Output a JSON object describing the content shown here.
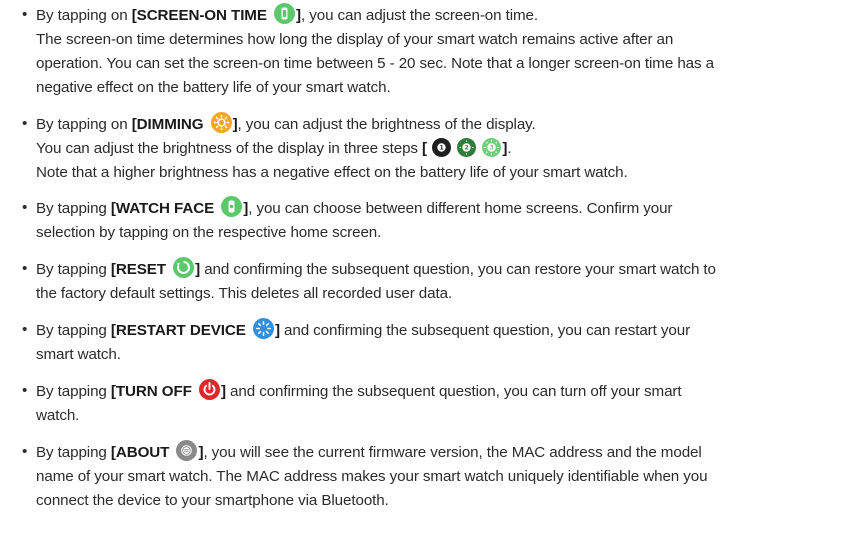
{
  "bullet_char": "•",
  "items": [
    {
      "lead": "By tapping on ",
      "name": "[SCREEN-ON TIME",
      "close": "]",
      "rest": ", you can adjust the screen-on time.",
      "lines": [
        "The screen-on time determines how long the display of your smart watch remains active after an",
        "operation. You can set the screen-on time between 5 - 20 sec. Note that a longer screen-on time has a",
        "negative effect on the battery life of your smart watch."
      ]
    },
    {
      "lead": "By tapping on ",
      "name": "[DIMMING",
      "close": "]",
      "rest": ", you can adjust the brightness of the display.",
      "steps_lead": "You can adjust the brightness of the display in three steps ",
      "steps_open": "[",
      "steps_close": "]",
      "steps_tail": ".",
      "step_labels": [
        "1",
        "2",
        "3"
      ],
      "note": "Note that a higher brightness has a negative effect on the battery life of your smart watch."
    },
    {
      "lead": "By tapping ",
      "name": "[WATCH FACE",
      "close": "]",
      "rest": ", you can choose between different home screens. Confirm your",
      "lines": [
        "selection by tapping on the respective home screen."
      ]
    },
    {
      "lead": "By tapping ",
      "name": "[RESET",
      "close": "]",
      "rest": " and confirming the subsequent question, you can restore your smart watch to",
      "lines": [
        "the factory default settings. This deletes all recorded user data."
      ]
    },
    {
      "lead": "By tapping ",
      "name": "[RESTART DEVICE",
      "close": "]",
      "rest": " and confirming the subsequent question, you can restart your",
      "lines": [
        "smart watch."
      ]
    },
    {
      "lead": "By tapping ",
      "name": "[TURN OFF",
      "close": "]",
      "rest": " and confirming the subsequent question, you can turn off your smart",
      "lines": [
        "watch."
      ]
    },
    {
      "lead": "By tapping ",
      "name": "[ABOUT",
      "close": "]",
      "rest": ", you will see the current firmware version, the MAC address and the model",
      "lines": [
        "name of your smart watch. The MAC address makes your smart watch uniquely identifiable when you",
        "connect the device to your smartphone via Bluetooth."
      ]
    }
  ],
  "icons": {
    "screen_on_time": "watch-icon",
    "dimming": "sun-icon",
    "step_1": "brightness-level-1-icon",
    "step_2": "brightness-level-2-icon",
    "step_3": "brightness-level-3-icon",
    "watch_face": "watch-face-icon",
    "reset": "reset-icon",
    "restart": "restart-spinner-icon",
    "turn_off": "power-icon",
    "about": "info-icon"
  },
  "colors": {
    "screen_on_time": "#5cc86a",
    "dimming": "#f5a623",
    "step_1": "#1f1f1f",
    "step_2": "#2f7d3a",
    "step_3": "#6fcf7a",
    "watch_face": "#5cc86a",
    "reset": "#5cc86a",
    "restart": "#2f8fe0",
    "turn_off": "#e0282a",
    "about": "#8a8a8a"
  }
}
